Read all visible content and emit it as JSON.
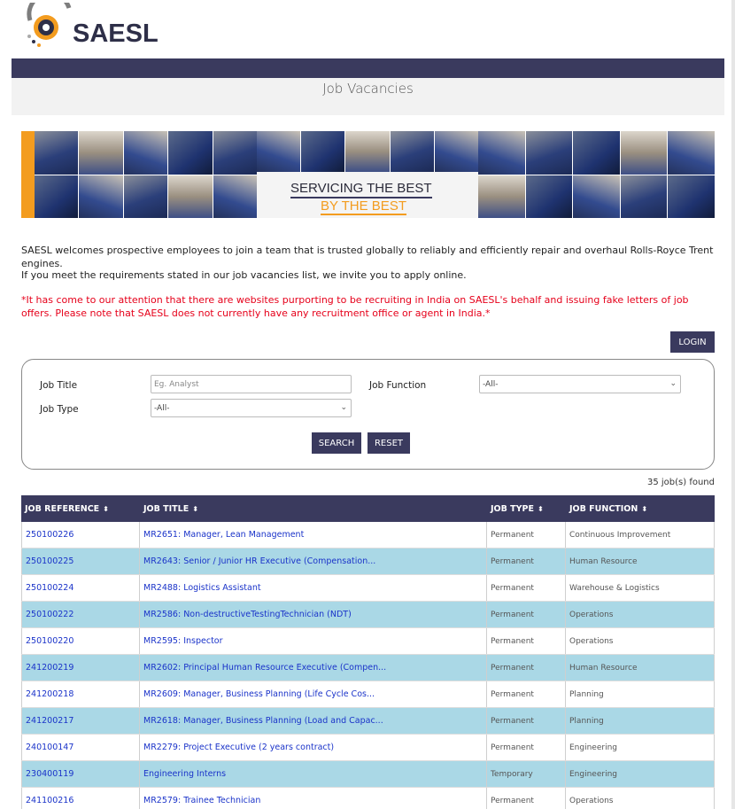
{
  "brand": {
    "name": "SAESL"
  },
  "page": {
    "title": "Job Vacancies"
  },
  "banner": {
    "line1": "SERVICING THE BEST",
    "line2": "BY THE BEST"
  },
  "intro": {
    "para1": "SAESL welcomes prospective employees to join a team that is trusted globally to reliably and efficiently repair and overhaul Rolls-Royce Trent engines.",
    "para2": "If you meet the requirements stated in our job vacancies list, we invite you to apply online.",
    "warning": "*It has come to our attention that there are websites purporting to be recruiting in India on SAESL's behalf and issuing fake letters of job offers. Please note that SAESL does not currently have any recruitment office or agent in India.*"
  },
  "login_label": "LOGIN",
  "search": {
    "job_title_label": "Job Title",
    "job_title_placeholder": "Eg. Analyst",
    "job_function_label": "Job Function",
    "job_function_value": "-All-",
    "job_type_label": "Job Type",
    "job_type_value": "-All-",
    "search_label": "SEARCH",
    "reset_label": "RESET"
  },
  "results_count": "35 job(s) found",
  "table": {
    "headers": [
      "JOB REFERENCE",
      "JOB TITLE",
      "JOB TYPE",
      "JOB FUNCTION"
    ],
    "rows": [
      {
        "ref": "250100226",
        "title": "MR2651: Manager, Lean Management",
        "type": "Permanent",
        "function": "Continuous Improvement"
      },
      {
        "ref": "250100225",
        "title": "MR2643: Senior / Junior HR Executive (Compensation...",
        "type": "Permanent",
        "function": "Human Resource"
      },
      {
        "ref": "250100224",
        "title": "MR2488: Logistics Assistant",
        "type": "Permanent",
        "function": "Warehouse & Logistics"
      },
      {
        "ref": "250100222",
        "title": "MR2586: Non-destructiveTestingTechnician (NDT)",
        "type": "Permanent",
        "function": "Operations"
      },
      {
        "ref": "250100220",
        "title": "MR2595: Inspector",
        "type": "Permanent",
        "function": "Operations"
      },
      {
        "ref": "241200219",
        "title": "MR2602: Principal Human Resource Executive (Compen...",
        "type": "Permanent",
        "function": "Human Resource"
      },
      {
        "ref": "241200218",
        "title": "MR2609: Manager, Business Planning (Life Cycle Cos...",
        "type": "Permanent",
        "function": "Planning"
      },
      {
        "ref": "241200217",
        "title": "MR2618: Manager, Business Planning (Load and Capac...",
        "type": "Permanent",
        "function": "Planning"
      },
      {
        "ref": "240100147",
        "title": "MR2279: Project Executive (2 years contract)",
        "type": "Permanent",
        "function": "Engineering"
      },
      {
        "ref": "230400119",
        "title": "Engineering Interns",
        "type": "Temporary",
        "function": "Engineering"
      },
      {
        "ref": "241100216",
        "title": "MR2579: Trainee Technician",
        "type": "Permanent",
        "function": "Operations"
      }
    ]
  },
  "colors": {
    "navy": "#3a3a5e",
    "row_alt": "#aad8e6",
    "link": "#1a33c9",
    "warning": "#e6001a",
    "accent_orange": "#f39c1f"
  },
  "icons": {
    "sort": "sort-arrows-icon",
    "dropdown": "chevron-down-icon"
  }
}
